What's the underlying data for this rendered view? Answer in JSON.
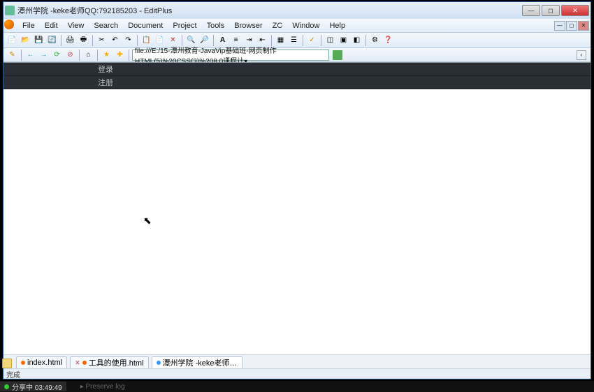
{
  "window": {
    "title": "潭州学院 -keke老师QQ:792185203 - EditPlus"
  },
  "menu": {
    "items": [
      "File",
      "Edit",
      "View",
      "Search",
      "Document",
      "Project",
      "Tools",
      "Browser",
      "ZC",
      "Window",
      "Help"
    ]
  },
  "addressbar": {
    "url": "file:///E:/15-潭州教育-JavaVip基础班-网页制作HTML(5)%20CSS(3)%208.0课程计▾"
  },
  "page": {
    "nav1": "登录",
    "nav2": "注册"
  },
  "tabs": {
    "t1": "index.html",
    "t2": "工具的使用.html",
    "t3": "潭州学院 -keke老师…"
  },
  "status": {
    "text": "完成"
  },
  "taskbar": {
    "share": "分享中 03:49:49",
    "faded": "▸ Preserve log"
  }
}
